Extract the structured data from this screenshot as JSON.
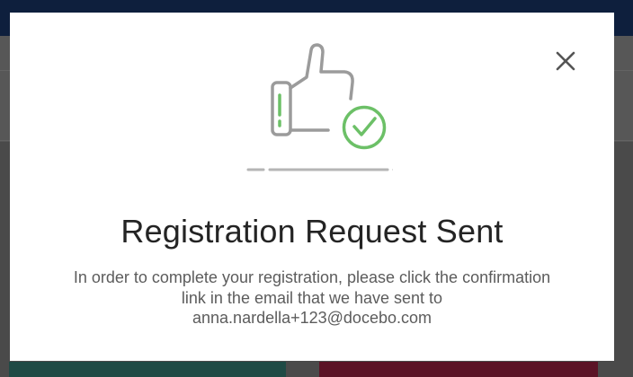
{
  "modal": {
    "title": "Registration Request Sent",
    "message_lines": [
      "In order to complete your registration, please click the confirmation",
      "link in the email that we have sent to",
      "anna.nardella+123@docebo.com"
    ],
    "close_icon": "close-icon",
    "illustration_icon": "thumbs-up-check-icon"
  },
  "colors": {
    "success_green": "#6cc067",
    "icon_gray": "#9b9b9b",
    "title_text": "#242424",
    "body_text": "#5c5c5c",
    "top_bar": "#0e1f3d"
  }
}
